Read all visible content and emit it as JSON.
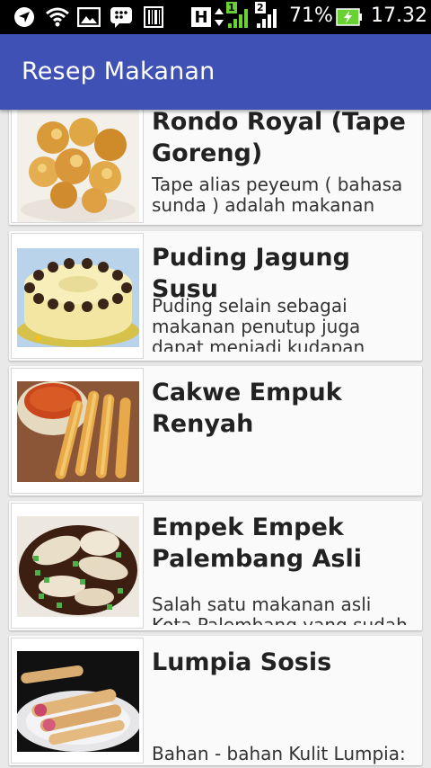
{
  "status_bar": {
    "icons": [
      "location-icon",
      "wifi-icon",
      "gallery-icon",
      "bbm-icon",
      "barcode-icon",
      "hplus-icon",
      "signal-sim1-icon",
      "signal-sim2-icon",
      "battery-charging-icon"
    ],
    "network_label": "H",
    "sim1_label": "1",
    "sim2_label": "2",
    "battery_percent": "71%",
    "time": "17.32"
  },
  "app_bar": {
    "title": "Resep Makanan",
    "color": "#3f51b5"
  },
  "recipes": [
    {
      "title": "Rondo Royal (Tape Goreng)",
      "description": "Tape alias peyeum ( bahasa sunda ) adalah makanan",
      "image": "fried-tape-image"
    },
    {
      "title": "Puding Jagung Susu",
      "description": "Puding selain sebagai makanan penutup juga dapat menjadi kudapan yang sehat",
      "image": "corn-pudding-image"
    },
    {
      "title": "Cakwe Empuk Renyah",
      "description": "",
      "image": "cakwe-image"
    },
    {
      "title": "Empek Empek Palembang Asli",
      "description": "Salah satu makanan asli Kota Palembang yang sudah",
      "image": "pempek-image"
    },
    {
      "title": "Lumpia Sosis",
      "description": "Bahan - bahan Kulit Lumpia:",
      "image": "lumpia-image"
    }
  ]
}
